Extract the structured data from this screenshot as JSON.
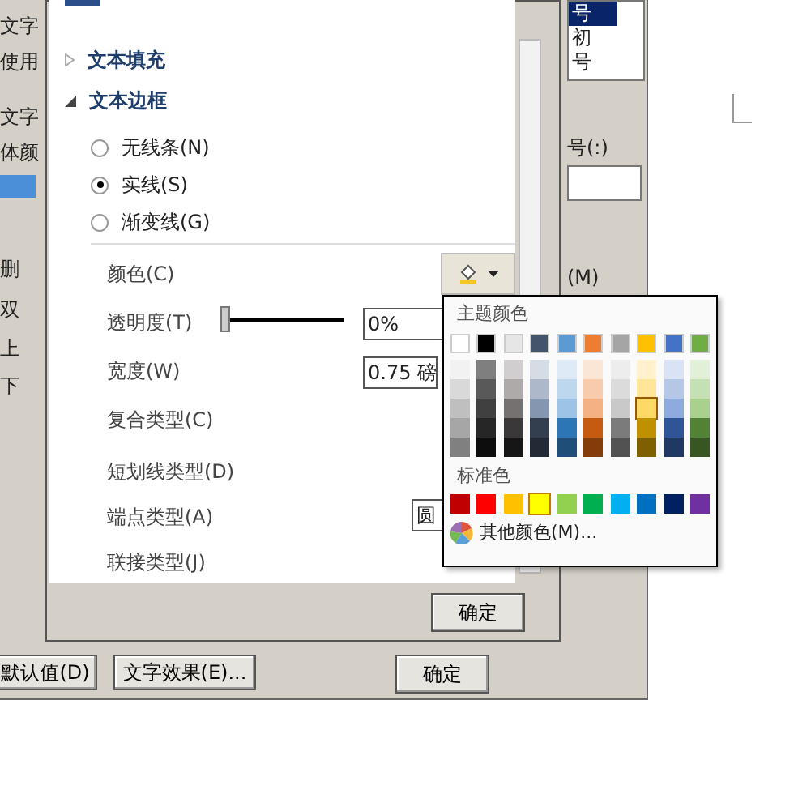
{
  "back_dialog": {
    "left_labels": [
      "文字",
      "使用",
      "文字",
      "体颜",
      "删",
      "双",
      "上",
      "下"
    ],
    "size_list": [
      {
        "label": "号",
        "selected": true
      },
      {
        "label": "初",
        "selected": false
      },
      {
        "label": "号",
        "selected": false
      }
    ],
    "label_right": "号(:)",
    "label_underline": "(M)",
    "buttons": [
      "默认值(D)",
      "文字效果(E)...",
      "确定"
    ]
  },
  "format_panel": {
    "sections": [
      {
        "label": "文本填充",
        "expanded": false
      },
      {
        "label": "文本边框",
        "expanded": true
      }
    ],
    "radios": [
      {
        "label": "无线条(N)",
        "selected": false
      },
      {
        "label": "实线(S)",
        "selected": true
      },
      {
        "label": "渐变线(G)",
        "selected": false
      }
    ],
    "properties": [
      {
        "kind": "color",
        "label": "颜色(C)"
      },
      {
        "kind": "slider",
        "label": "透明度(T)",
        "level": 0.0,
        "value": "0%"
      },
      {
        "kind": "field",
        "label": "宽度(W)",
        "value": "0.75 磅"
      },
      {
        "kind": "plain",
        "label": "复合类型(C)"
      },
      {
        "kind": "plain",
        "label": "短划线类型(D)"
      },
      {
        "kind": "field",
        "label": "端点类型(A)",
        "value": "圆"
      },
      {
        "kind": "plain",
        "label": "联接类型(J)"
      }
    ],
    "ok_button": "确定"
  },
  "color_popup": {
    "theme_title": "主题颜色",
    "theme_colors": [
      {
        "color": "#ffffff",
        "shades": [
          {
            "color": "#f2f2f2",
            "selected": false
          },
          {
            "color": "#d9d9d9",
            "selected": false
          },
          {
            "color": "#bfbfbf",
            "selected": false
          },
          {
            "color": "#a6a6a6",
            "selected": false
          },
          {
            "color": "#808080",
            "selected": false
          }
        ]
      },
      {
        "color": "#000000",
        "shades": [
          {
            "color": "#7f7f7f",
            "selected": false
          },
          {
            "color": "#595959",
            "selected": false
          },
          {
            "color": "#404040",
            "selected": false
          },
          {
            "color": "#262626",
            "selected": false
          },
          {
            "color": "#0d0d0d",
            "selected": false
          }
        ]
      },
      {
        "color": "#e7e6e6",
        "shades": [
          {
            "color": "#d0cece",
            "selected": false
          },
          {
            "color": "#aeaaaa",
            "selected": false
          },
          {
            "color": "#757171",
            "selected": false
          },
          {
            "color": "#3a3838",
            "selected": false
          },
          {
            "color": "#171616",
            "selected": false
          }
        ]
      },
      {
        "color": "#44546a",
        "shades": [
          {
            "color": "#d6dce4",
            "selected": false
          },
          {
            "color": "#adb9ca",
            "selected": false
          },
          {
            "color": "#8496b0",
            "selected": false
          },
          {
            "color": "#333f4f",
            "selected": false
          },
          {
            "color": "#222a35",
            "selected": false
          }
        ]
      },
      {
        "color": "#5b9bd5",
        "shades": [
          {
            "color": "#deebf6",
            "selected": false
          },
          {
            "color": "#bdd7ee",
            "selected": false
          },
          {
            "color": "#9dc3e6",
            "selected": false
          },
          {
            "color": "#2e75b5",
            "selected": false
          },
          {
            "color": "#1f4e79",
            "selected": false
          }
        ]
      },
      {
        "color": "#ed7d31",
        "shades": [
          {
            "color": "#fbe5d5",
            "selected": false
          },
          {
            "color": "#f7cbac",
            "selected": false
          },
          {
            "color": "#f4b183",
            "selected": false
          },
          {
            "color": "#c55a11",
            "selected": false
          },
          {
            "color": "#843c0b",
            "selected": false
          }
        ]
      },
      {
        "color": "#a5a5a5",
        "shades": [
          {
            "color": "#ededed",
            "selected": false
          },
          {
            "color": "#dbdbdb",
            "selected": false
          },
          {
            "color": "#c9c9c9",
            "selected": false
          },
          {
            "color": "#7b7b7b",
            "selected": false
          },
          {
            "color": "#525252",
            "selected": false
          }
        ]
      },
      {
        "color": "#ffc000",
        "shades": [
          {
            "color": "#fff2cc",
            "selected": false
          },
          {
            "color": "#fee599",
            "selected": false
          },
          {
            "color": "#ffd966",
            "selected": true
          },
          {
            "color": "#bf9000",
            "selected": false
          },
          {
            "color": "#7f6000",
            "selected": false
          }
        ]
      },
      {
        "color": "#4472c4",
        "shades": [
          {
            "color": "#dae3f3",
            "selected": false
          },
          {
            "color": "#b4c7e7",
            "selected": false
          },
          {
            "color": "#8faadc",
            "selected": false
          },
          {
            "color": "#2f5597",
            "selected": false
          },
          {
            "color": "#203864",
            "selected": false
          }
        ]
      },
      {
        "color": "#70ad47",
        "shades": [
          {
            "color": "#e2f0d9",
            "selected": false
          },
          {
            "color": "#c5e0b4",
            "selected": false
          },
          {
            "color": "#a9d18e",
            "selected": false
          },
          {
            "color": "#538135",
            "selected": false
          },
          {
            "color": "#375623",
            "selected": false
          }
        ]
      }
    ],
    "standard_title": "标准色",
    "standard_colors": [
      {
        "color": "#c00000",
        "selected": false
      },
      {
        "color": "#ff0000",
        "selected": false
      },
      {
        "color": "#ffc000",
        "selected": false
      },
      {
        "color": "#ffff00",
        "selected": true
      },
      {
        "color": "#92d050",
        "selected": false
      },
      {
        "color": "#00b050",
        "selected": false
      },
      {
        "color": "#00b0f0",
        "selected": false
      },
      {
        "color": "#0070c0",
        "selected": false
      },
      {
        "color": "#002060",
        "selected": false
      },
      {
        "color": "#7030a0",
        "selected": false
      }
    ],
    "more_colors": "其他颜色(M)..."
  }
}
